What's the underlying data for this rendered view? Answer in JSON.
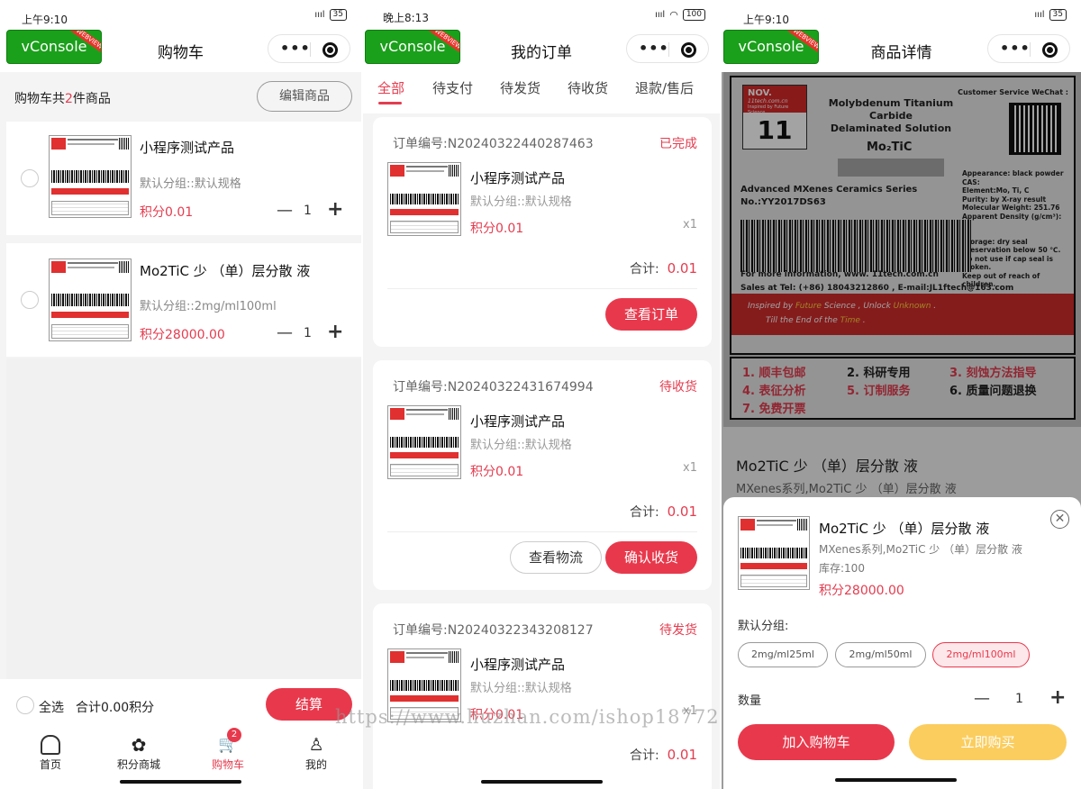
{
  "screen1": {
    "status_time": "上午9:10",
    "battery": "35",
    "title": "购物车",
    "vconsole": "vConsole",
    "webview_tag": "WEBVIEW",
    "cart_count_prefix": "购物车共",
    "cart_count_num": "2",
    "cart_count_suffix": "件商品",
    "edit_label": "编辑商品",
    "items": [
      {
        "name": "小程序测试产品",
        "spec": "默认分组::默认规格",
        "price": "积分0.01",
        "qty": "1"
      },
      {
        "name": "Mo2TiC 少 （单）层分散 液",
        "spec": "默认分组::2mg/ml100ml",
        "price": "积分28000.00",
        "qty": "1"
      }
    ],
    "select_all": "全选",
    "total": "合计0.00积分",
    "checkout": "结算",
    "tabs": [
      {
        "label": "首页",
        "icon": "home-icon"
      },
      {
        "label": "积分商城",
        "icon": "grid-icon"
      },
      {
        "label": "购物车",
        "icon": "cart-icon",
        "badge": "2"
      },
      {
        "label": "我的",
        "icon": "person-icon"
      }
    ]
  },
  "screen2": {
    "status_time": "晚上8:13",
    "battery": "100",
    "title": "我的订单",
    "vconsole": "vConsole",
    "webview_tag": "WEBVIEW",
    "tabs": [
      "全部",
      "待支付",
      "待发货",
      "待收货",
      "退款/售后"
    ],
    "orders": [
      {
        "no": "订单编号:N20240322440287463",
        "status": "已完成",
        "name": "小程序测试产品",
        "spec": "默认分组::默认规格",
        "price": "积分0.01",
        "qty": "x1",
        "sum_label": "合计:",
        "sum": "0.01",
        "btn1": "",
        "btn2": "查看订单"
      },
      {
        "no": "订单编号:N20240322431674994",
        "status": "待收货",
        "name": "小程序测试产品",
        "spec": "默认分组::默认规格",
        "price": "积分0.01",
        "qty": "x1",
        "sum_label": "合计:",
        "sum": "0.01",
        "btn1": "查看物流",
        "btn2": "确认收货"
      },
      {
        "no": "订单编号:N20240322343208127",
        "status": "待发货",
        "name": "小程序测试产品",
        "spec": "默认分组::默认规格",
        "price": "积分0.01",
        "qty": "x1",
        "sum_label": "合计:",
        "sum": "0.01"
      }
    ]
  },
  "screen3": {
    "status_time": "上午9:10",
    "battery": "35",
    "title": "商品详情",
    "vconsole": "vConsole",
    "webview_tag": "WEBVIEW",
    "poster": {
      "nov": "NOV.",
      "nov_site": "11tech.com.cn",
      "nov_tag": "Inspired by Future Science",
      "nov_num": "11",
      "title1": "Molybdenum Titanium Carbide",
      "title2": "Delaminated Solution",
      "formula": "Mo₂TiC",
      "cs": "Customer Service WeChat :",
      "specs": [
        "Appearance: black powder",
        "CAS:",
        "Element:Mo, Ti, C",
        "Purity: by X-ray result",
        "Molecular Weight: 251.76",
        "Apparent Density (g/cm³):",
        "---",
        "",
        "Storage: dry seal",
        "preservation below 50 ℃.",
        "Do not use if cap seal is",
        "broken.",
        "Keep out of reach of",
        "children."
      ],
      "series": "Advanced MXenes Ceramics Series",
      "no": "No.:YY2017DS63",
      "more": "For more information, www. 11tech.com.cn",
      "sales": "Sales at Tel: (+86) 18043212860 , E-mail:JL1ftech@163.com",
      "band1a": "Inspired by ",
      "band1b": "Future",
      "band1c": " Science , Unlock ",
      "band1d": "Unknown",
      "band1e": " .",
      "band2a": "Till the End of the ",
      "band2b": "Time",
      "band2c": " .",
      "features": [
        "1. 顺丰包邮",
        "2. 科研专用",
        "3. 刻蚀方法指导",
        "4. 表征分析",
        "5. 订制服务",
        "6. 质量问题退换",
        "7. 免费开票"
      ]
    },
    "name": "Mo2TiC 少 （单）层分散 液",
    "sub": "MXenes系列,Mo2TiC 少 （单）层分散 液",
    "sheet": {
      "name": "Mo2TiC 少 （单）层分散 液",
      "sub": "MXenes系列,Mo2TiC 少 （单）层分散 液",
      "stock": "库存:100",
      "price": "积分28000.00",
      "group_label": "默认分组:",
      "options": [
        "2mg/ml25ml",
        "2mg/ml50ml",
        "2mg/ml100ml"
      ],
      "selected": "2mg/ml100ml",
      "qty_label": "数量",
      "qty": "1",
      "add_cart": "加入购物车",
      "buy_now": "立即购买"
    }
  },
  "watermark": "https://www.huzhan.com/ishop18772",
  "colors": {
    "accent": "#e8394c",
    "buy": "#fbcd5e",
    "vconsole": "#1ba01b"
  }
}
